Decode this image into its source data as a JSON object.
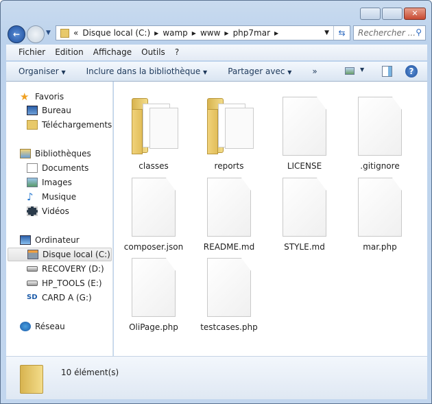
{
  "window": {
    "controls": [
      "minimize",
      "maximize",
      "close"
    ]
  },
  "address": {
    "overflow": "«",
    "crumbs": [
      "Disque local (C:)",
      "wamp",
      "www",
      "php7mar"
    ],
    "search_placeholder": "Rechercher ..."
  },
  "menu": [
    "Fichier",
    "Edition",
    "Affichage",
    "Outils",
    "?"
  ],
  "commands": {
    "organise": "Organiser",
    "include": "Inclure dans la bibliothèque",
    "share": "Partager avec",
    "more": "»"
  },
  "nav": {
    "favorites": {
      "label": "Favoris",
      "items": [
        "Bureau",
        "Téléchargements"
      ]
    },
    "libraries": {
      "label": "Bibliothèques",
      "items": [
        "Documents",
        "Images",
        "Musique",
        "Vidéos"
      ]
    },
    "computer": {
      "label": "Ordinateur",
      "items": [
        "Disque local (C:)",
        "RECOVERY (D:)",
        "HP_TOOLS (E:)",
        "CARD A (G:)"
      ],
      "selected": "Disque local (C:)"
    },
    "network": {
      "label": "Réseau"
    }
  },
  "files": [
    {
      "name": "classes",
      "type": "folder"
    },
    {
      "name": "reports",
      "type": "folder"
    },
    {
      "name": "LICENSE",
      "type": "file"
    },
    {
      "name": ".gitignore",
      "type": "file"
    },
    {
      "name": "composer.json",
      "type": "file"
    },
    {
      "name": "README.md",
      "type": "file"
    },
    {
      "name": "STYLE.md",
      "type": "file"
    },
    {
      "name": "mar.php",
      "type": "file"
    },
    {
      "name": "OliPage.php",
      "type": "file"
    },
    {
      "name": "testcases.php",
      "type": "file"
    }
  ],
  "status": {
    "count": "10 élément(s)"
  }
}
